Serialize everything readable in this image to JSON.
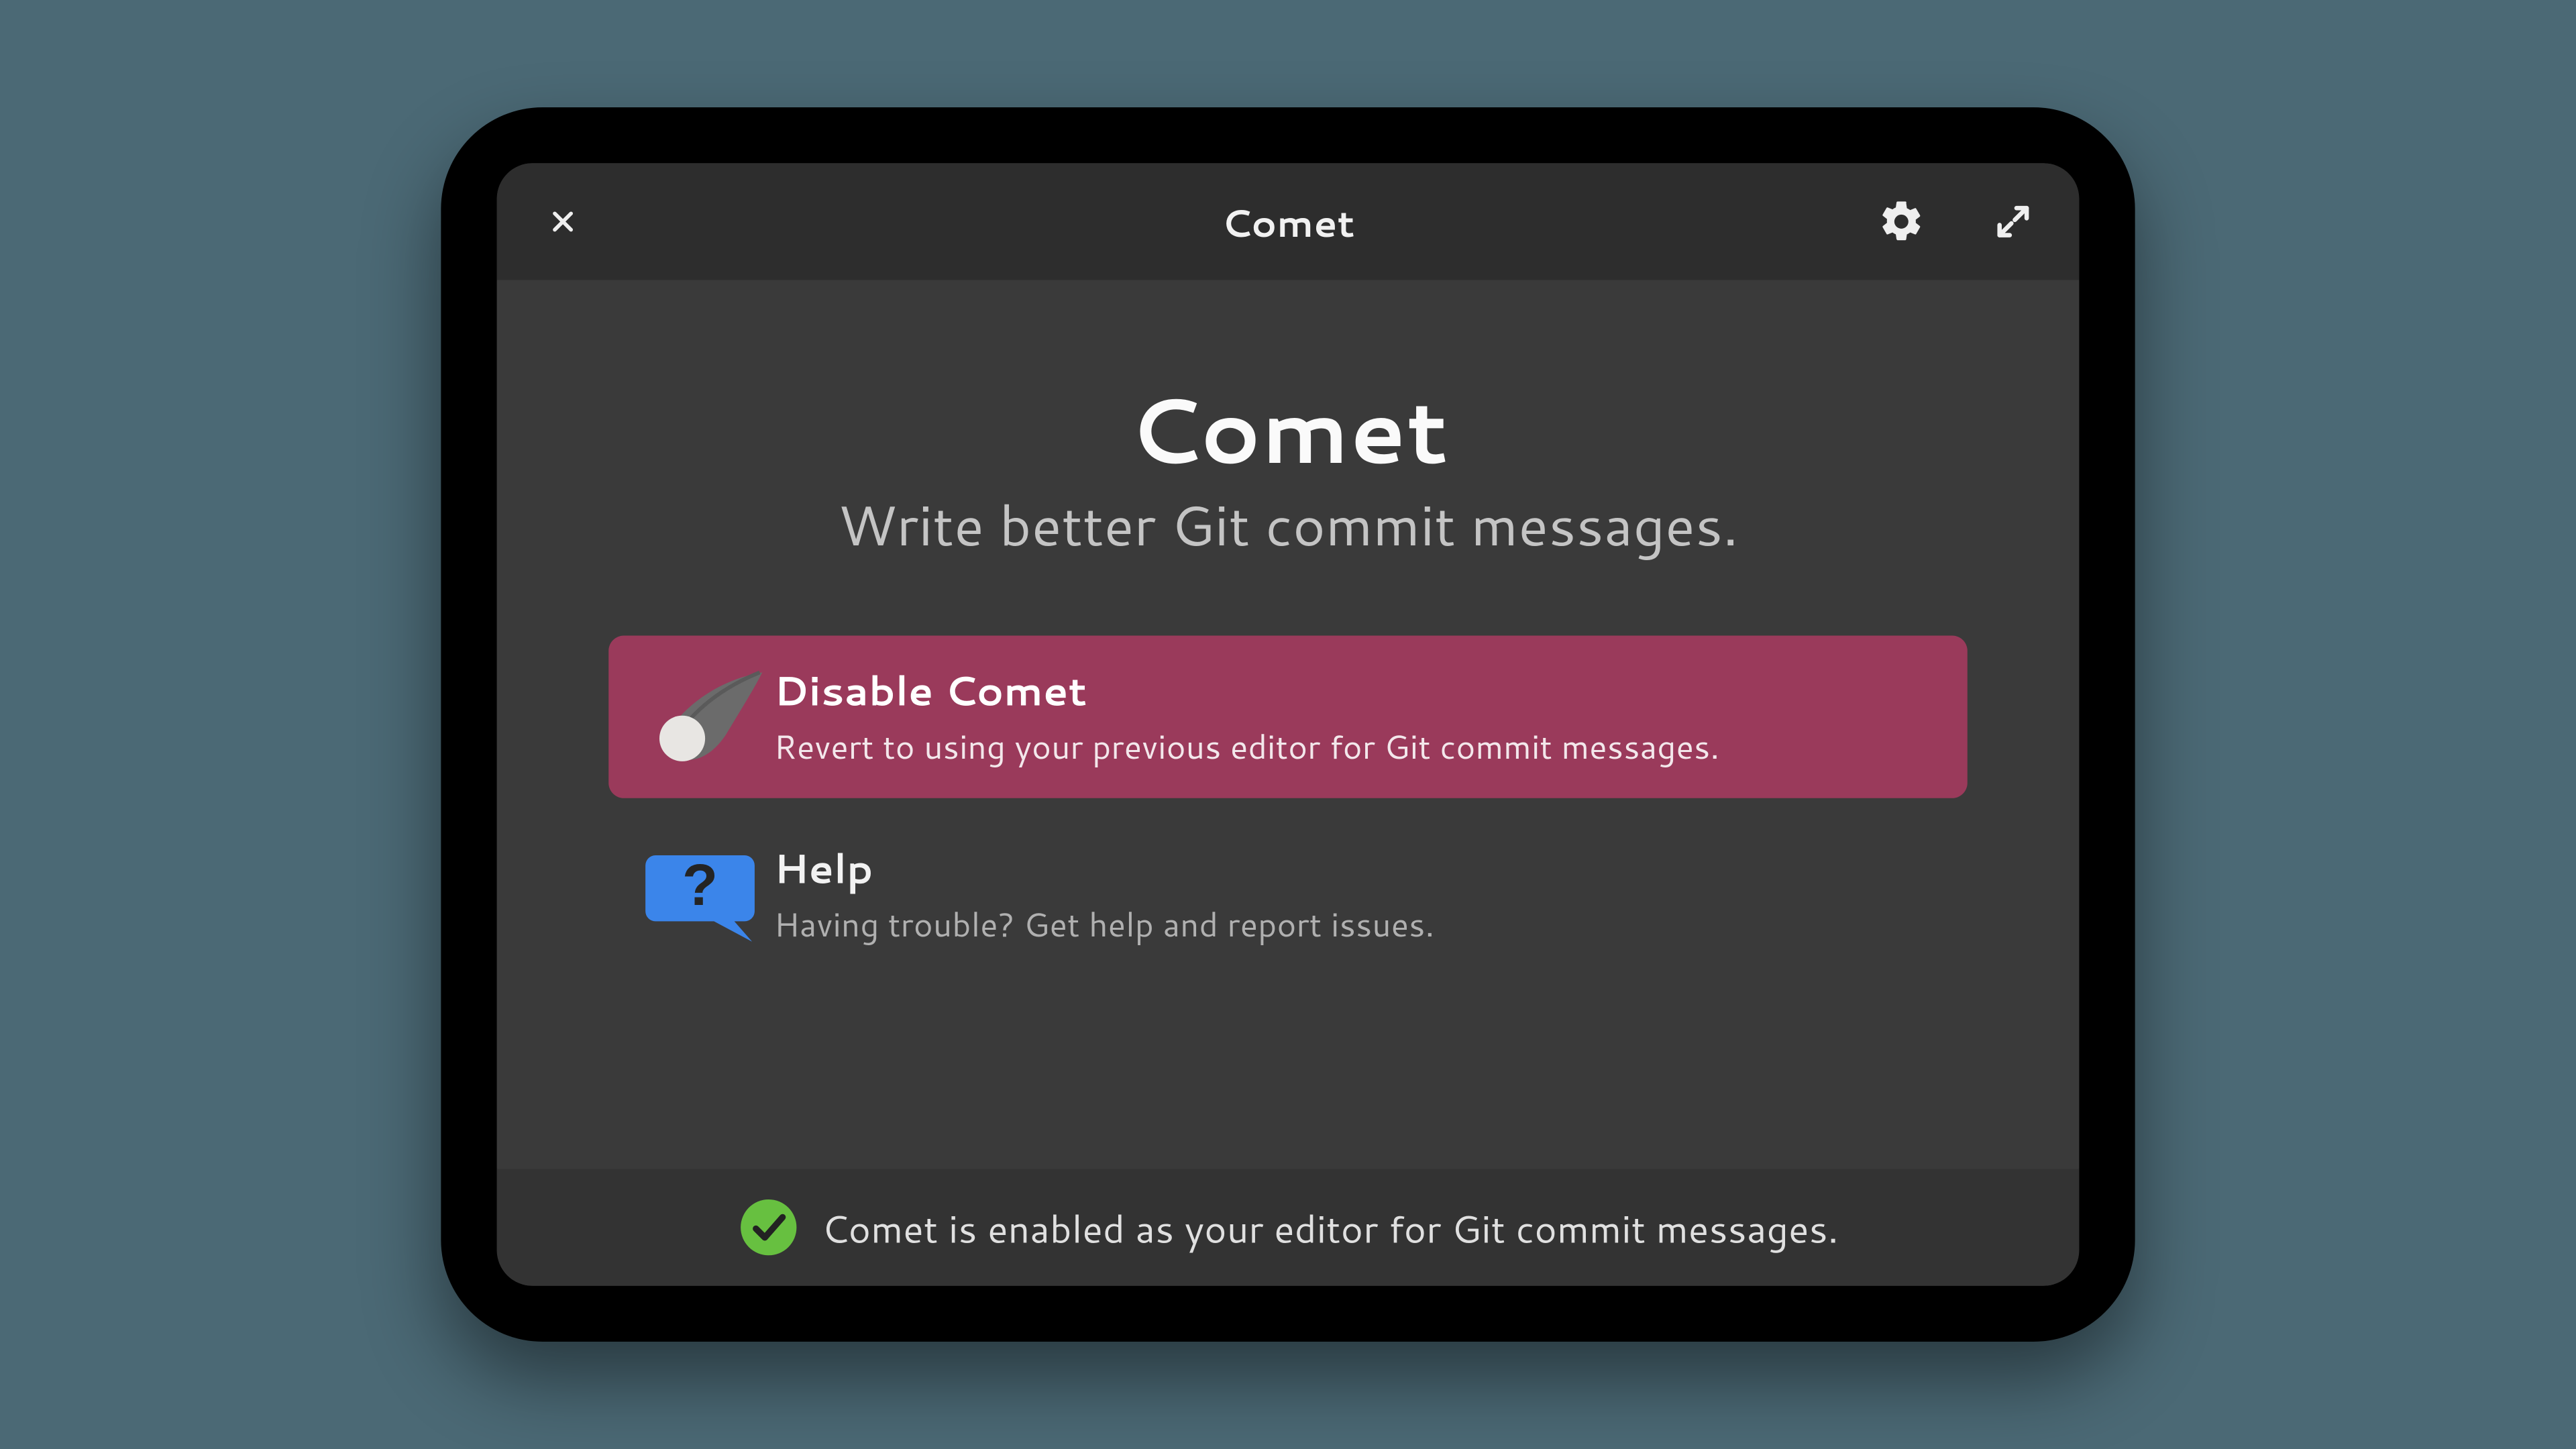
{
  "titlebar": {
    "title": "Comet",
    "close": "Close",
    "gear": "Preferences",
    "expand": "Fullscreen"
  },
  "headline": "Comet",
  "subhead": "Write better Git commit messages.",
  "rows": {
    "disable": {
      "title": "Disable Comet",
      "sub": "Revert to using your previous editor for Git commit messages."
    },
    "help": {
      "title": "Help",
      "sub": "Having trouble? Get help and report issues."
    }
  },
  "status": {
    "text": "Comet is enabled as your editor for Git commit messages."
  },
  "colors": {
    "accent": "#9a3a5b",
    "ok": "#67c040",
    "help": "#3b85ea"
  }
}
